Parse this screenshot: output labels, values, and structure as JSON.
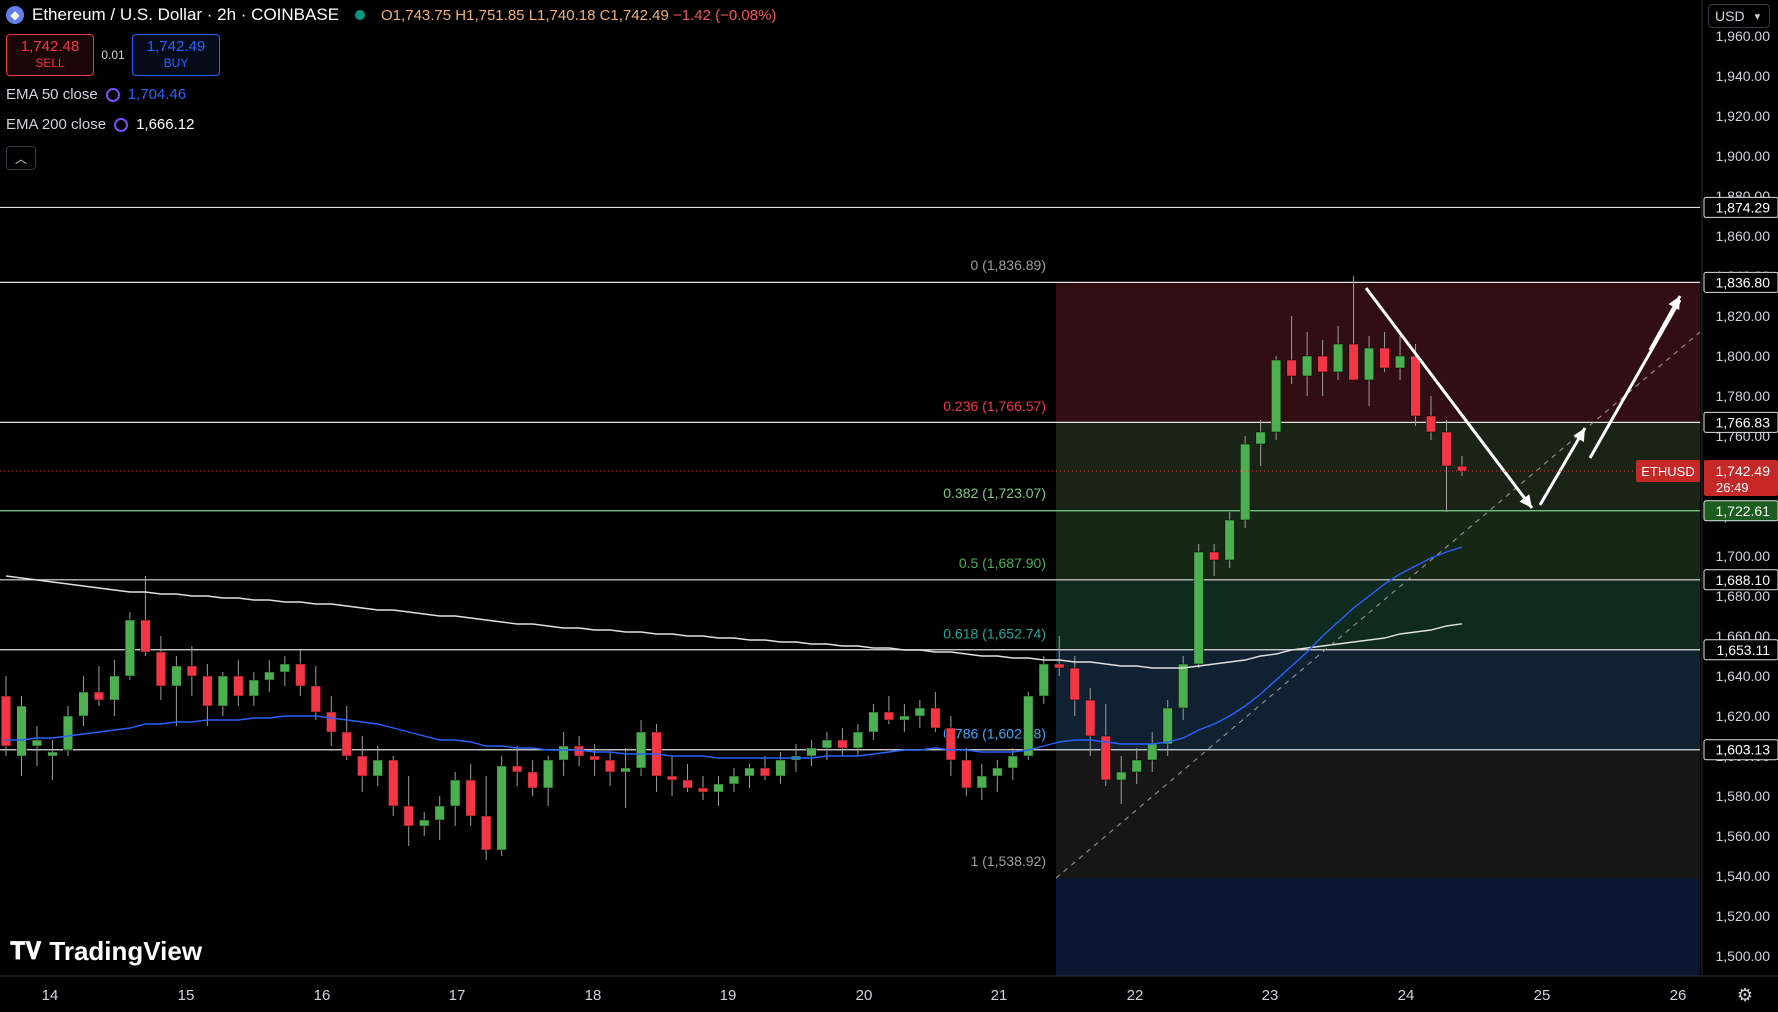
{
  "header": {
    "title": "Ethereum / U.S. Dollar · 2h · COINBASE",
    "open": "O1,743.75",
    "high": "H1,751.85",
    "low": "L1,740.18",
    "close": "C1,742.49",
    "change": "−1.42 (−0.08%)"
  },
  "trade": {
    "sell_price": "1,742.48",
    "sell_label": "SELL",
    "spread": "0.01",
    "buy_price": "1,742.49",
    "buy_label": "BUY"
  },
  "indicators": {
    "ema50_label": "EMA 50 close",
    "ema50_value": "1,704.46",
    "ema200_label": "EMA 200 close",
    "ema200_value": "1,666.12"
  },
  "currency_selector": "USD",
  "branding": "TradingView",
  "last_price_tag": {
    "symbol": "ETHUSD",
    "price": "1,742.49",
    "countdown": "26:49"
  },
  "colors": {
    "up": "#4caf50",
    "down": "#f23645",
    "ema50": "#2962ff",
    "ema200": "#e0e0e0",
    "accent": "#2962ff"
  },
  "chart_data": {
    "type": "candlestick",
    "instrument": "ETHUSD",
    "interval": "2h",
    "y_axis": {
      "min": 1500,
      "max": 1960,
      "ticks": [
        1500,
        1520,
        1540,
        1560,
        1580,
        1600,
        1620,
        1640,
        1660,
        1680,
        1700,
        1720,
        1740,
        1760,
        1780,
        1800,
        1820,
        1840,
        1860,
        1880,
        1900,
        1920,
        1940,
        1960
      ]
    },
    "x_axis": {
      "labels": [
        "14",
        "15",
        "16",
        "17",
        "18",
        "19",
        "20",
        "21",
        "22",
        "23",
        "24",
        "25",
        "26"
      ]
    },
    "fib_levels": [
      {
        "ratio": "0",
        "label": "0 (1,836.89)",
        "price": 1836.89
      },
      {
        "ratio": "0.236",
        "label": "0.236 (1,766.57)",
        "price": 1766.57
      },
      {
        "ratio": "0.382",
        "label": "0.382 (1,723.07)",
        "price": 1723.07
      },
      {
        "ratio": "0.5",
        "label": "0.5 (1,687.90)",
        "price": 1687.9
      },
      {
        "ratio": "0.618",
        "label": "0.618 (1,652.74)",
        "price": 1652.74
      },
      {
        "ratio": "0.786",
        "label": "0.786 (1,602.68)",
        "price": 1602.68
      },
      {
        "ratio": "1",
        "label": "1 (1,538.92)",
        "price": 1538.92
      }
    ],
    "horizontal_lines": [
      {
        "label": "1,874.29",
        "price": 1874.29
      },
      {
        "label": "1,836.80",
        "price": 1836.8
      },
      {
        "label": "1,766.83",
        "price": 1766.83
      },
      {
        "label": "1,722.61",
        "price": 1722.61,
        "highlight": true
      },
      {
        "label": "1,688.10",
        "price": 1688.1
      },
      {
        "label": "1,653.11",
        "price": 1653.11
      },
      {
        "label": "1,603.13",
        "price": 1603.13
      }
    ],
    "candles": [
      [
        1630,
        1640,
        1600,
        1605
      ],
      [
        1600,
        1630,
        1590,
        1625
      ],
      [
        1605,
        1615,
        1595,
        1608
      ],
      [
        1600,
        1608,
        1588,
        1602
      ],
      [
        1603,
        1625,
        1600,
        1620
      ],
      [
        1620,
        1640,
        1615,
        1632
      ],
      [
        1632,
        1645,
        1625,
        1628
      ],
      [
        1628,
        1648,
        1620,
        1640
      ],
      [
        1640,
        1672,
        1638,
        1668
      ],
      [
        1668,
        1690,
        1650,
        1652
      ],
      [
        1652,
        1660,
        1628,
        1635
      ],
      [
        1635,
        1650,
        1615,
        1645
      ],
      [
        1645,
        1655,
        1630,
        1640
      ],
      [
        1640,
        1646,
        1615,
        1625
      ],
      [
        1625,
        1642,
        1620,
        1640
      ],
      [
        1640,
        1648,
        1625,
        1630
      ],
      [
        1630,
        1642,
        1625,
        1638
      ],
      [
        1638,
        1648,
        1632,
        1642
      ],
      [
        1642,
        1650,
        1635,
        1646
      ],
      [
        1646,
        1653,
        1630,
        1635
      ],
      [
        1635,
        1645,
        1618,
        1622
      ],
      [
        1622,
        1630,
        1605,
        1612
      ],
      [
        1612,
        1625,
        1598,
        1600
      ],
      [
        1600,
        1610,
        1582,
        1590
      ],
      [
        1590,
        1605,
        1585,
        1598
      ],
      [
        1598,
        1600,
        1570,
        1575
      ],
      [
        1575,
        1590,
        1555,
        1565
      ],
      [
        1565,
        1572,
        1560,
        1568
      ],
      [
        1568,
        1580,
        1558,
        1575
      ],
      [
        1575,
        1592,
        1565,
        1588
      ],
      [
        1588,
        1596,
        1565,
        1570
      ],
      [
        1570,
        1590,
        1548,
        1553
      ],
      [
        1553,
        1600,
        1550,
        1595
      ],
      [
        1595,
        1605,
        1585,
        1592
      ],
      [
        1592,
        1598,
        1580,
        1584
      ],
      [
        1584,
        1600,
        1575,
        1598
      ],
      [
        1598,
        1612,
        1590,
        1605
      ],
      [
        1605,
        1610,
        1595,
        1600
      ],
      [
        1600,
        1606,
        1590,
        1598
      ],
      [
        1598,
        1602,
        1585,
        1592
      ],
      [
        1592,
        1604,
        1574,
        1594
      ],
      [
        1594,
        1618,
        1590,
        1612
      ],
      [
        1612,
        1616,
        1582,
        1590
      ],
      [
        1590,
        1600,
        1580,
        1588
      ],
      [
        1588,
        1596,
        1582,
        1584
      ],
      [
        1584,
        1590,
        1578,
        1582
      ],
      [
        1582,
        1590,
        1575,
        1586
      ],
      [
        1586,
        1594,
        1582,
        1590
      ],
      [
        1590,
        1596,
        1584,
        1594
      ],
      [
        1594,
        1600,
        1588,
        1590
      ],
      [
        1590,
        1602,
        1586,
        1598
      ],
      [
        1598,
        1606,
        1592,
        1600
      ],
      [
        1600,
        1608,
        1595,
        1604
      ],
      [
        1604,
        1612,
        1598,
        1608
      ],
      [
        1608,
        1614,
        1600,
        1604
      ],
      [
        1604,
        1616,
        1600,
        1612
      ],
      [
        1612,
        1626,
        1608,
        1622
      ],
      [
        1622,
        1630,
        1616,
        1618
      ],
      [
        1618,
        1626,
        1612,
        1620
      ],
      [
        1620,
        1628,
        1614,
        1624
      ],
      [
        1624,
        1632,
        1612,
        1614
      ],
      [
        1614,
        1620,
        1590,
        1598
      ],
      [
        1598,
        1604,
        1580,
        1584
      ],
      [
        1584,
        1596,
        1578,
        1590
      ],
      [
        1590,
        1598,
        1582,
        1594
      ],
      [
        1594,
        1604,
        1588,
        1600
      ],
      [
        1600,
        1632,
        1598,
        1630
      ],
      [
        1630,
        1650,
        1626,
        1646
      ],
      [
        1646,
        1660,
        1640,
        1644
      ],
      [
        1644,
        1650,
        1620,
        1628
      ],
      [
        1628,
        1634,
        1600,
        1610
      ],
      [
        1610,
        1626,
        1585,
        1588
      ],
      [
        1588,
        1600,
        1576,
        1592
      ],
      [
        1592,
        1604,
        1586,
        1598
      ],
      [
        1598,
        1612,
        1592,
        1606
      ],
      [
        1606,
        1628,
        1600,
        1624
      ],
      [
        1624,
        1650,
        1618,
        1646
      ],
      [
        1646,
        1706,
        1644,
        1702
      ],
      [
        1702,
        1706,
        1690,
        1698
      ],
      [
        1698,
        1722,
        1694,
        1718
      ],
      [
        1718,
        1760,
        1714,
        1756
      ],
      [
        1756,
        1768,
        1745,
        1762
      ],
      [
        1762,
        1800,
        1758,
        1798
      ],
      [
        1798,
        1820,
        1786,
        1790
      ],
      [
        1790,
        1812,
        1780,
        1800
      ],
      [
        1800,
        1808,
        1780,
        1792
      ],
      [
        1792,
        1815,
        1788,
        1806
      ],
      [
        1806,
        1840,
        1790,
        1788
      ],
      [
        1788,
        1810,
        1775,
        1804
      ],
      [
        1804,
        1812,
        1792,
        1794
      ],
      [
        1794,
        1810,
        1788,
        1800
      ],
      [
        1800,
        1806,
        1765,
        1770
      ],
      [
        1770,
        1780,
        1758,
        1762
      ],
      [
        1762,
        1768,
        1722,
        1745
      ],
      [
        1745,
        1750,
        1740,
        1742.49
      ]
    ],
    "ema50": [
      1608,
      1608,
      1609,
      1609,
      1610,
      1611,
      1612,
      1613,
      1614,
      1616,
      1616,
      1617,
      1617,
      1618,
      1618,
      1618,
      1619,
      1619,
      1620,
      1620,
      1620,
      1619,
      1618,
      1617,
      1616,
      1614,
      1612,
      1610,
      1608,
      1608,
      1607,
      1605,
      1605,
      1604,
      1604,
      1603,
      1603,
      1603,
      1602,
      1602,
      1601,
      1601,
      1601,
      1600,
      1600,
      1600,
      1599,
      1599,
      1599,
      1599,
      1599,
      1599,
      1599,
      1600,
      1600,
      1600,
      1601,
      1602,
      1603,
      1603,
      1604,
      1603,
      1603,
      1602,
      1602,
      1602,
      1603,
      1605,
      1607,
      1608,
      1608,
      1607,
      1606,
      1606,
      1606,
      1607,
      1609,
      1613,
      1616,
      1620,
      1625,
      1631,
      1638,
      1645,
      1652,
      1660,
      1667,
      1674,
      1680,
      1686,
      1691,
      1695,
      1699,
      1702,
      1704.46
    ],
    "ema200": [
      1690,
      1689,
      1688,
      1687,
      1686,
      1685,
      1684,
      1683,
      1682,
      1682,
      1681,
      1681,
      1680,
      1680,
      1679,
      1679,
      1678,
      1678,
      1677,
      1677,
      1676,
      1676,
      1675,
      1674,
      1673,
      1673,
      1672,
      1671,
      1670,
      1670,
      1669,
      1668,
      1667,
      1666,
      1666,
      1665,
      1664,
      1664,
      1663,
      1663,
      1662,
      1662,
      1661,
      1661,
      1660,
      1660,
      1659,
      1659,
      1658,
      1658,
      1657,
      1657,
      1656,
      1656,
      1655,
      1655,
      1654,
      1654,
      1653,
      1653,
      1652,
      1652,
      1651,
      1650,
      1650,
      1649,
      1649,
      1648,
      1648,
      1647,
      1647,
      1646,
      1645,
      1645,
      1644,
      1644,
      1644,
      1645,
      1646,
      1647,
      1648,
      1650,
      1651,
      1653,
      1654,
      1655,
      1656,
      1657,
      1658,
      1659,
      1661,
      1662,
      1663,
      1665,
      1666.12
    ]
  }
}
